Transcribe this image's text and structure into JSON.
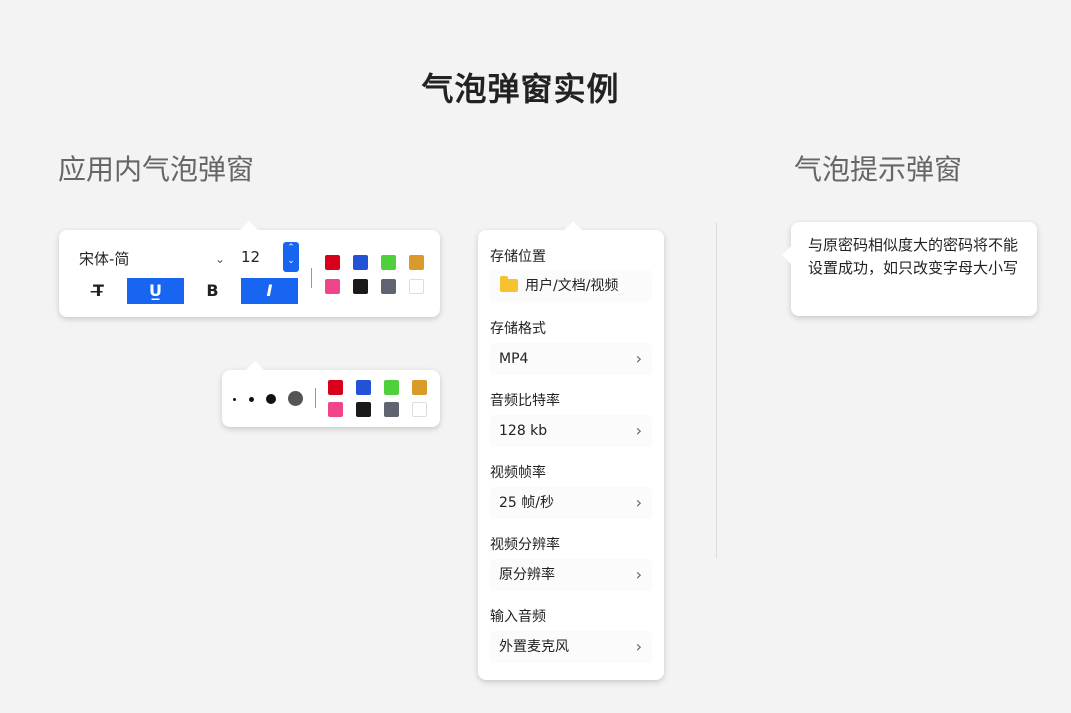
{
  "page_title": "气泡弹窗实例",
  "headings": {
    "in_app": "应用内气泡弹窗",
    "tip": "气泡提示弹窗"
  },
  "font_toolbar": {
    "font_name": "宋体-简",
    "font_size": "12",
    "format_buttons": [
      {
        "name": "strikethrough",
        "glyph": "T̶",
        "active": false
      },
      {
        "name": "underline",
        "glyph": "U̲",
        "active": true
      },
      {
        "name": "bold",
        "glyph": "B",
        "active": false
      },
      {
        "name": "italic",
        "glyph": "I",
        "active": true
      }
    ]
  },
  "colors": [
    "#d9001b",
    "#2253d6",
    "#4fcf3a",
    "#d89b2b",
    "#f0458a",
    "#1a1a1a",
    "#5f6470",
    "#ffffff"
  ],
  "brush_sizes": [
    "tiny",
    "small",
    "medium",
    "large"
  ],
  "settings_panel": {
    "storage_location": {
      "label": "存储位置",
      "value": "用户/文档/视频",
      "icon": "folder-icon"
    },
    "storage_format": {
      "label": "存储格式",
      "value": "MP4"
    },
    "audio_bitrate": {
      "label": "音频比特率",
      "value": "128 kb"
    },
    "video_framerate": {
      "label": "视频帧率",
      "value": "25 帧/秒"
    },
    "video_resolution": {
      "label": "视频分辨率",
      "value": "原分辨率"
    },
    "audio_input": {
      "label": "输入音频",
      "value": "外置麦克风"
    }
  },
  "tooltip": {
    "text": "与原密码相似度大的密码将不能设置成功，如只改变字母大小写"
  },
  "accent_color": "#1765f0"
}
